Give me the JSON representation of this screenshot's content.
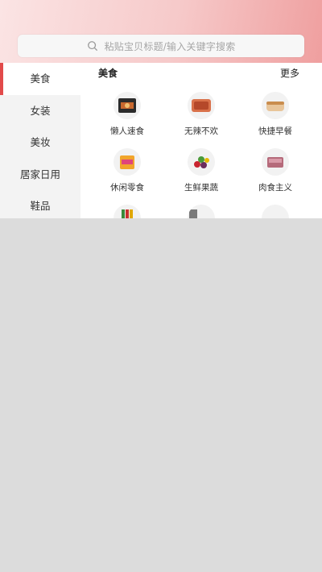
{
  "search": {
    "placeholder": "粘贴宝贝标题/输入关键字搜索"
  },
  "sidebar": {
    "items": [
      {
        "label": "美食",
        "active": true
      },
      {
        "label": "女装",
        "active": false
      },
      {
        "label": "美妆",
        "active": false
      },
      {
        "label": "居家日用",
        "active": false
      },
      {
        "label": "鞋品",
        "active": false
      }
    ]
  },
  "section": {
    "title": "美食",
    "more_label": "更多",
    "items": [
      {
        "label": "懒人速食",
        "icon": "instant-food-icon"
      },
      {
        "label": "无辣不欢",
        "icon": "spicy-meat-icon"
      },
      {
        "label": "快捷早餐",
        "icon": "breakfast-bread-icon"
      },
      {
        "label": "休闲零食",
        "icon": "snack-pack-icon"
      },
      {
        "label": "生鲜果蔬",
        "icon": "fresh-produce-icon"
      },
      {
        "label": "肉食主义",
        "icon": "meat-pack-icon"
      }
    ]
  },
  "colors": {
    "accent": "#e24a4a",
    "header_gradient_end": "#ef9f9f"
  }
}
